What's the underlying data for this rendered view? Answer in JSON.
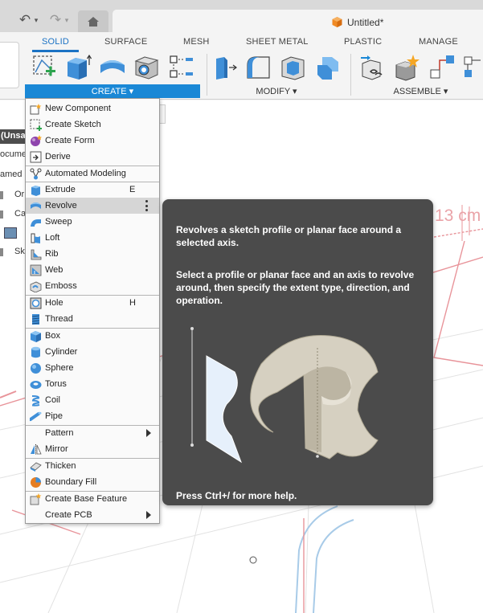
{
  "window": {
    "document_title": "Untitled*"
  },
  "workspace_tabs": [
    "SOLID",
    "SURFACE",
    "MESH",
    "SHEET METAL",
    "PLASTIC",
    "MANAGE"
  ],
  "groups": {
    "create": "CREATE ▾",
    "modify": "MODIFY ▾",
    "assemble": "ASSEMBLE ▾"
  },
  "browser": {
    "header": "(Unsa",
    "rows": [
      "ocume",
      "amed",
      "Or",
      "Ca",
      "",
      "Sk"
    ]
  },
  "canvas": {
    "dimension_label": "13 cm"
  },
  "create_menu": {
    "items": [
      {
        "label": "New Component",
        "icon": "new-component-icon"
      },
      {
        "label": "Create Sketch",
        "icon": "create-sketch-icon"
      },
      {
        "label": "Create Form",
        "icon": "create-form-icon"
      },
      {
        "label": "Derive",
        "icon": "derive-icon"
      },
      {
        "label": "Automated Modeling",
        "icon": "automated-modeling-icon"
      },
      {
        "label": "Extrude",
        "shortcut": "E",
        "icon": "extrude-icon"
      },
      {
        "label": "Revolve",
        "icon": "revolve-icon",
        "highlighted": true
      },
      {
        "label": "Sweep",
        "icon": "sweep-icon"
      },
      {
        "label": "Loft",
        "icon": "loft-icon"
      },
      {
        "label": "Rib",
        "icon": "rib-icon"
      },
      {
        "label": "Web",
        "icon": "web-icon"
      },
      {
        "label": "Emboss",
        "icon": "emboss-icon"
      },
      {
        "label": "Hole",
        "shortcut": "H",
        "icon": "hole-icon"
      },
      {
        "label": "Thread",
        "icon": "thread-icon"
      },
      {
        "label": "Box",
        "icon": "box-icon"
      },
      {
        "label": "Cylinder",
        "icon": "cylinder-icon"
      },
      {
        "label": "Sphere",
        "icon": "sphere-icon"
      },
      {
        "label": "Torus",
        "icon": "torus-icon"
      },
      {
        "label": "Coil",
        "icon": "coil-icon"
      },
      {
        "label": "Pipe",
        "icon": "pipe-icon"
      },
      {
        "label": "Pattern",
        "submenu": true
      },
      {
        "label": "Mirror",
        "icon": "mirror-icon"
      },
      {
        "label": "Thicken",
        "icon": "thicken-icon"
      },
      {
        "label": "Boundary Fill",
        "icon": "boundary-fill-icon"
      },
      {
        "label": "Create Base Feature",
        "icon": "base-feature-icon"
      },
      {
        "label": "Create PCB",
        "submenu": true
      }
    ]
  },
  "tooltip": {
    "description": "Revolves a sketch profile or planar face around a selected axis.",
    "instructions": "Select a profile or planar face and an axis to revolve around, then specify the extent type, direction, and operation.",
    "help": "Press Ctrl+/ for more help."
  },
  "colors": {
    "accent": "#1b72c4",
    "create_group": "#1a88d6",
    "tooltip_bg": "#4b4b4b",
    "grid_red": "#e8949a"
  }
}
